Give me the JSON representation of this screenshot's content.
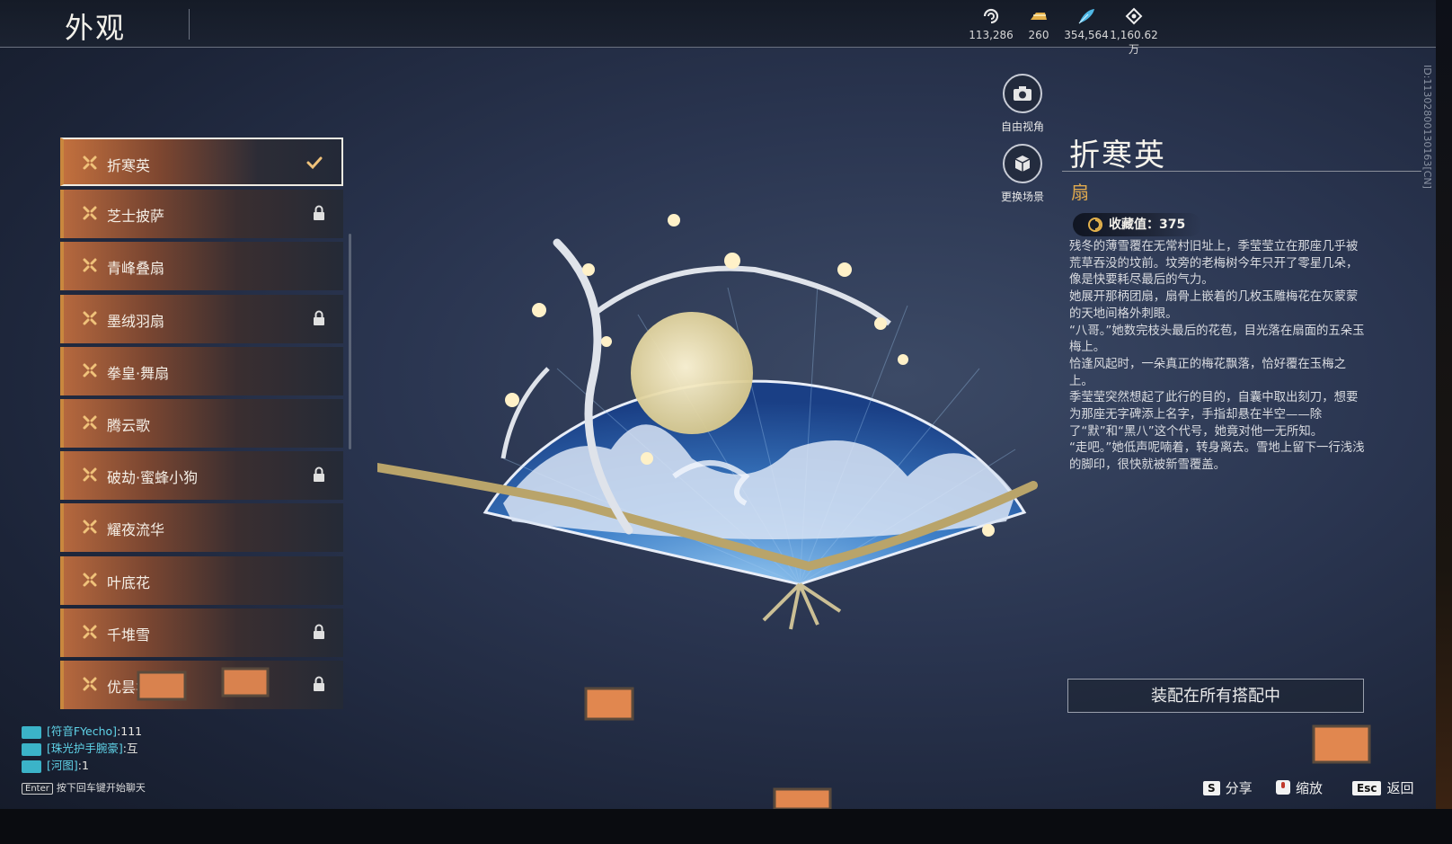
{
  "page": {
    "title": "外观"
  },
  "currencies": [
    {
      "icon": "spiral-token-icon",
      "value": "113,286"
    },
    {
      "icon": "gold-ingot-icon",
      "value": "260"
    },
    {
      "icon": "feather-quill-icon",
      "value": "354,564"
    },
    {
      "icon": "diamond-eye-icon",
      "value": "1,160.62万"
    }
  ],
  "list": {
    "items": [
      {
        "label": "折寒英",
        "state": "selected"
      },
      {
        "label": "芝士披萨",
        "state": "locked"
      },
      {
        "label": "青峰叠扇",
        "state": "normal"
      },
      {
        "label": "墨绒羽扇",
        "state": "locked"
      },
      {
        "label": "拳皇·舞扇",
        "state": "normal"
      },
      {
        "label": "腾云歌",
        "state": "normal"
      },
      {
        "label": "破劫·蜜蜂小狗",
        "state": "locked"
      },
      {
        "label": "耀夜流华",
        "state": "normal"
      },
      {
        "label": "叶底花",
        "state": "normal"
      },
      {
        "label": "千堆雪",
        "state": "locked"
      },
      {
        "label": "优昙华",
        "state": "locked"
      }
    ]
  },
  "side_buttons": {
    "free_view": "自由视角",
    "change_scene": "更换场景"
  },
  "detail": {
    "name": "折寒英",
    "type": "扇",
    "collect_label": "收藏值：375",
    "description": [
      "残冬的薄雪覆在无常村旧址上，季莹莹立在那座几乎被荒草吞没的坟前。坟旁的老梅树今年只开了零星几朵，像是快要耗尽最后的气力。",
      "她展开那柄团扇，扇骨上嵌着的几枚玉雕梅花在灰蒙蒙的天地间格外刺眼。",
      "“八哥。”她数完枝头最后的花苞，目光落在扇面的五朵玉梅上。",
      "恰逢风起时，一朵真正的梅花飘落，恰好覆在玉梅之上。",
      "季莹莹突然想起了此行的目的，自囊中取出刻刀，想要为那座无字碑添上名字，手指却悬在半空——除了“默”和“黑八”这个代号，她竟对他一无所知。",
      "“走吧。”她低声呢喃着，转身离去。雪地上留下一行浅浅的脚印，很快就被新雪覆盖。"
    ],
    "equip_button": "装配在所有搭配中",
    "vertical_id": "ID:11302800130163[CN]"
  },
  "chat": {
    "lines": [
      {
        "channel": "[符音FYecho]",
        "text": ":111"
      },
      {
        "channel": "[珠光护手腕豪]",
        "text": ":互"
      },
      {
        "channel": "[河图]",
        "text": ":1"
      }
    ],
    "enter_key": "Enter",
    "hint": "按下回车键开始聊天"
  },
  "footer": {
    "share_key": "S",
    "share_label": "分享",
    "zoom_label": "缩放",
    "back_key": "Esc",
    "back_label": "返回"
  }
}
